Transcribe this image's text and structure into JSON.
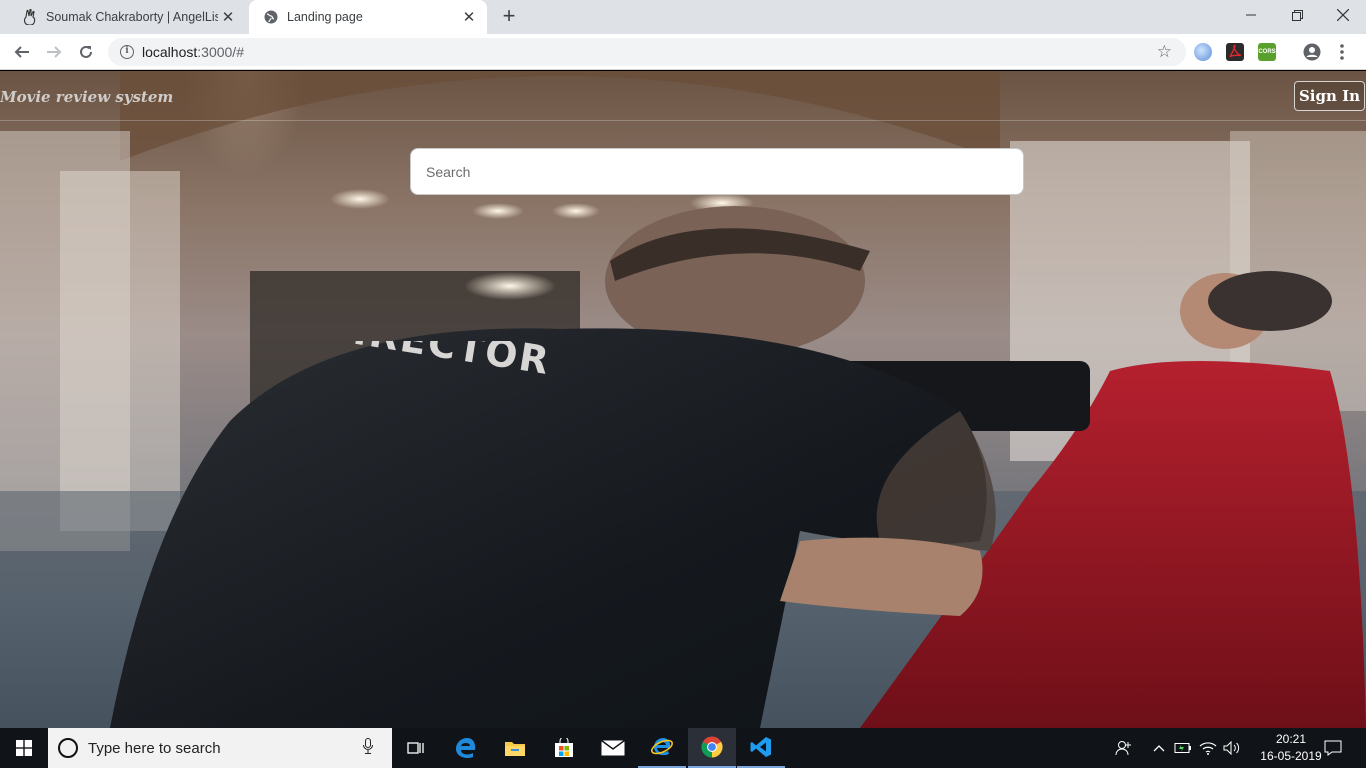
{
  "browser": {
    "tabs": [
      {
        "title": "Soumak Chakraborty | AngelList",
        "favicon": "angellist-icon",
        "active": false
      },
      {
        "title": "Landing page",
        "favicon": "globe-icon",
        "active": true
      }
    ],
    "new_tab_label": "+",
    "address": {
      "host": "localhost",
      "rest": ":3000/#"
    },
    "window_controls": {
      "minimize": "—",
      "restore": "❐",
      "close": "✕"
    }
  },
  "page": {
    "brand": "Movie review system",
    "sign_in_label": "Sign In",
    "search_placeholder": "Search",
    "background_text": "DIRECTOR"
  },
  "taskbar": {
    "search_placeholder": "Type here to search",
    "pinned": [
      "task-view-icon",
      "edge-icon",
      "file-explorer-icon",
      "store-icon",
      "mail-icon",
      "internet-explorer-icon",
      "chrome-icon",
      "vscode-icon"
    ],
    "time": "20:21",
    "date": "16-05-2019"
  },
  "colors": {
    "tabstrip": "#dee1e6",
    "taskbar": "#101418",
    "accent": "#7aa7de"
  }
}
